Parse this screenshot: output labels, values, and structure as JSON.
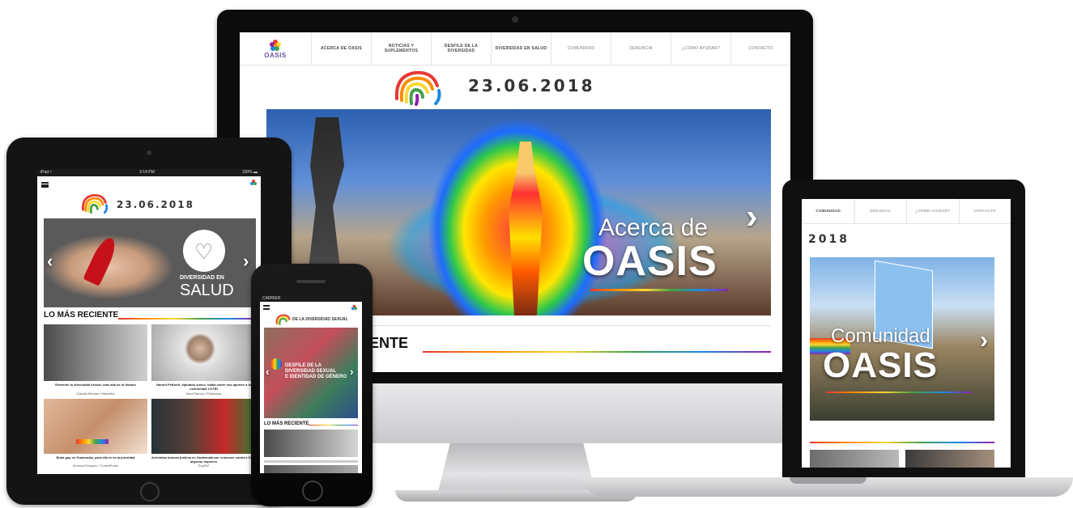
{
  "imac": {
    "nav": {
      "logo": "OASIS",
      "items": [
        {
          "label": "ACERCA DE OASIS",
          "style": "bold"
        },
        {
          "label": "NOTICIAS Y SUPLEMENTOS",
          "style": "bold"
        },
        {
          "label": "DESFILE DE LA DIVERSIDAD",
          "style": "bold"
        },
        {
          "label": "DIVERSIDAD EN SALUD",
          "style": "bold"
        },
        {
          "label": "COMUNIDAD",
          "style": "light"
        },
        {
          "label": "DENUNCIA",
          "style": "light"
        },
        {
          "label": "¿CÓMO AYUDAR?",
          "style": "light"
        },
        {
          "label": "CONTACTO",
          "style": "light"
        }
      ]
    },
    "date": "23.06.2018",
    "hero": {
      "line1": "Acerca de",
      "line2": "OASIS",
      "next": "›"
    },
    "section_title": "ENTE"
  },
  "ipad": {
    "status": {
      "left": "iPad ≈",
      "center": "3:14 PM",
      "right": "100% ▬"
    },
    "menu_icon": "hamburger-icon",
    "date": "23.06.2018",
    "hero": {
      "logo_line1": "DIVERSIDAD EN",
      "logo_line2": "SALUD",
      "prev": "‹",
      "next": "›"
    },
    "section_title": "LO MÁS RECIENTE",
    "articles": [
      {
        "title": "Entender la diversidad sexual: más allá de lo binario",
        "author": "Claudia Mendez Villaseñor"
      },
      {
        "title": "Harold Pettorid, diputado sueco, habla sobre sus aportes a la comunidad LGTBI",
        "author": "Sara Ramos / Publinews"
      },
      {
        "title": "Boda gay en Guatemala, para ella lo es la prioridad",
        "author": "Ximena Enriquez / ContraPoder"
      },
      {
        "title": "Activistas buscan justicia en Guatemala por crímenes contra LGBTI algunos impunes",
        "author": "Soy502"
      }
    ]
  },
  "iphone": {
    "status": {
      "left": "CARRIER"
    },
    "menu_icon": "hamburger-icon",
    "header_text": "DE LA DIVERSIDAD SEXUAL",
    "hero": {
      "line1": "DESFILE DE LA",
      "line2": "DIVERSIDAD SEXUAL",
      "line3": "E IDENTIDAD DE GÉNERO",
      "prev": "‹",
      "next": "›"
    },
    "section_title": "LO MÁS RECIENTE"
  },
  "laptop": {
    "nav": [
      "COMUNIDAD",
      "DENUNCIA",
      "¿CÓMO AYUDAR?",
      "CONTACTO"
    ],
    "date": "2018",
    "hero": {
      "line1": "Comunidad",
      "line2": "OASIS",
      "next": "›"
    }
  },
  "colors": {
    "rainbow": [
      "#e53935",
      "#fb8c00",
      "#fdd835",
      "#43a047",
      "#1e88e5",
      "#8e24aa"
    ],
    "brand": "#6a4fa0"
  }
}
